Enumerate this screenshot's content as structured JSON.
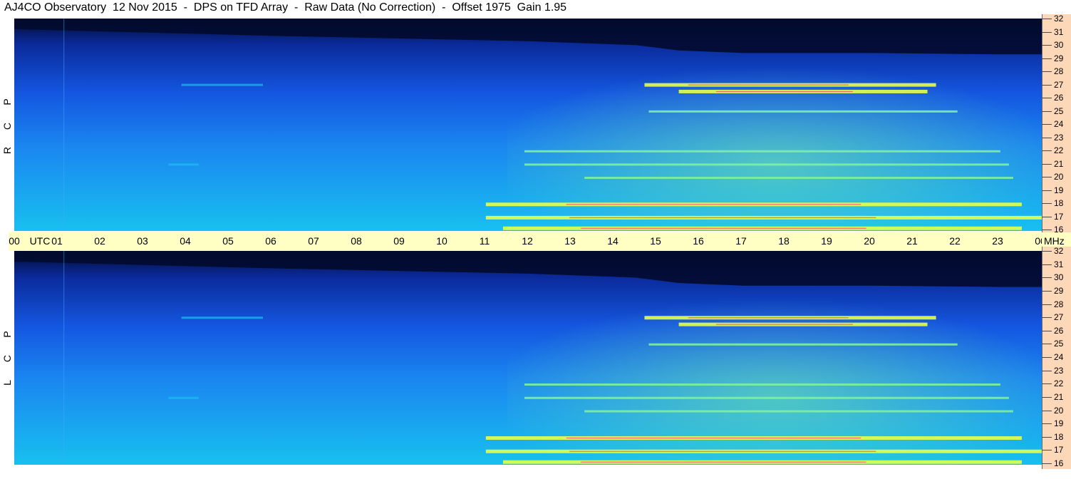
{
  "title": "AJ4CO Observatory  12 Nov 2015  -  DPS on TFD Array  -  Raw Data (No Correction)  -  Offset 1975  Gain 1.95",
  "panels": {
    "rcp": {
      "label": [
        "R",
        "C",
        "P"
      ]
    },
    "lcp": {
      "label": [
        "L",
        "C",
        "P"
      ]
    }
  },
  "time_axis": {
    "utc_label": "UTC",
    "ticks": [
      "00",
      "01",
      "02",
      "03",
      "04",
      "05",
      "06",
      "07",
      "08",
      "09",
      "10",
      "11",
      "12",
      "13",
      "14",
      "15",
      "16",
      "17",
      "18",
      "19",
      "20",
      "21",
      "22",
      "23",
      "00"
    ],
    "unit": "MHz"
  },
  "freq_axis": {
    "ticks": [
      "32",
      "31",
      "30",
      "29",
      "28",
      "27",
      "26",
      "25",
      "24",
      "23",
      "22",
      "21",
      "20",
      "19",
      "18",
      "17",
      "16"
    ]
  },
  "colors": {
    "background": "#0a2a9a",
    "quiet": "#1a6cf0",
    "cyan": "#19c0f0",
    "green": "#7ef0a0",
    "yellow": "#e6ff4a",
    "red": "#ff4a7a",
    "magenta": "#ff40ff",
    "axis_band": "#ffffc4",
    "freq_band": "#fcd7b8"
  },
  "chart_data": {
    "type": "heatmap",
    "title": "AJ4CO Observatory  12 Nov 2015  -  DPS on TFD Array  -  Raw Data (No Correction)  -  Offset 1975  Gain 1.95",
    "xlabel": "UTC",
    "ylabel": "MHz",
    "x_range": [
      0,
      24
    ],
    "y_range": [
      16,
      32
    ],
    "panels": [
      "RCP",
      "LCP"
    ],
    "features": [
      {
        "freq_mhz": 27.0,
        "start_utc": 14.7,
        "end_utc": 21.5,
        "intensity": "high"
      },
      {
        "freq_mhz": 26.5,
        "start_utc": 15.5,
        "end_utc": 21.3,
        "intensity": "high"
      },
      {
        "freq_mhz": 25.0,
        "start_utc": 14.8,
        "end_utc": 22.0,
        "intensity": "medium"
      },
      {
        "freq_mhz": 22.0,
        "start_utc": 11.9,
        "end_utc": 23.0,
        "intensity": "medium"
      },
      {
        "freq_mhz": 21.0,
        "start_utc": 11.9,
        "end_utc": 23.2,
        "intensity": "medium"
      },
      {
        "freq_mhz": 20.0,
        "start_utc": 13.3,
        "end_utc": 23.3,
        "intensity": "medium"
      },
      {
        "freq_mhz": 18.0,
        "start_utc": 11.0,
        "end_utc": 23.5,
        "intensity": "high"
      },
      {
        "freq_mhz": 17.0,
        "start_utc": 11.0,
        "end_utc": 24.0,
        "intensity": "high"
      },
      {
        "freq_mhz": 16.2,
        "start_utc": 11.4,
        "end_utc": 23.5,
        "intensity": "high"
      },
      {
        "freq_mhz": 27.0,
        "start_utc": 3.9,
        "end_utc": 5.8,
        "intensity": "low"
      },
      {
        "freq_mhz": 21.0,
        "start_utc": 3.6,
        "end_utc": 4.3,
        "intensity": "low"
      }
    ]
  }
}
